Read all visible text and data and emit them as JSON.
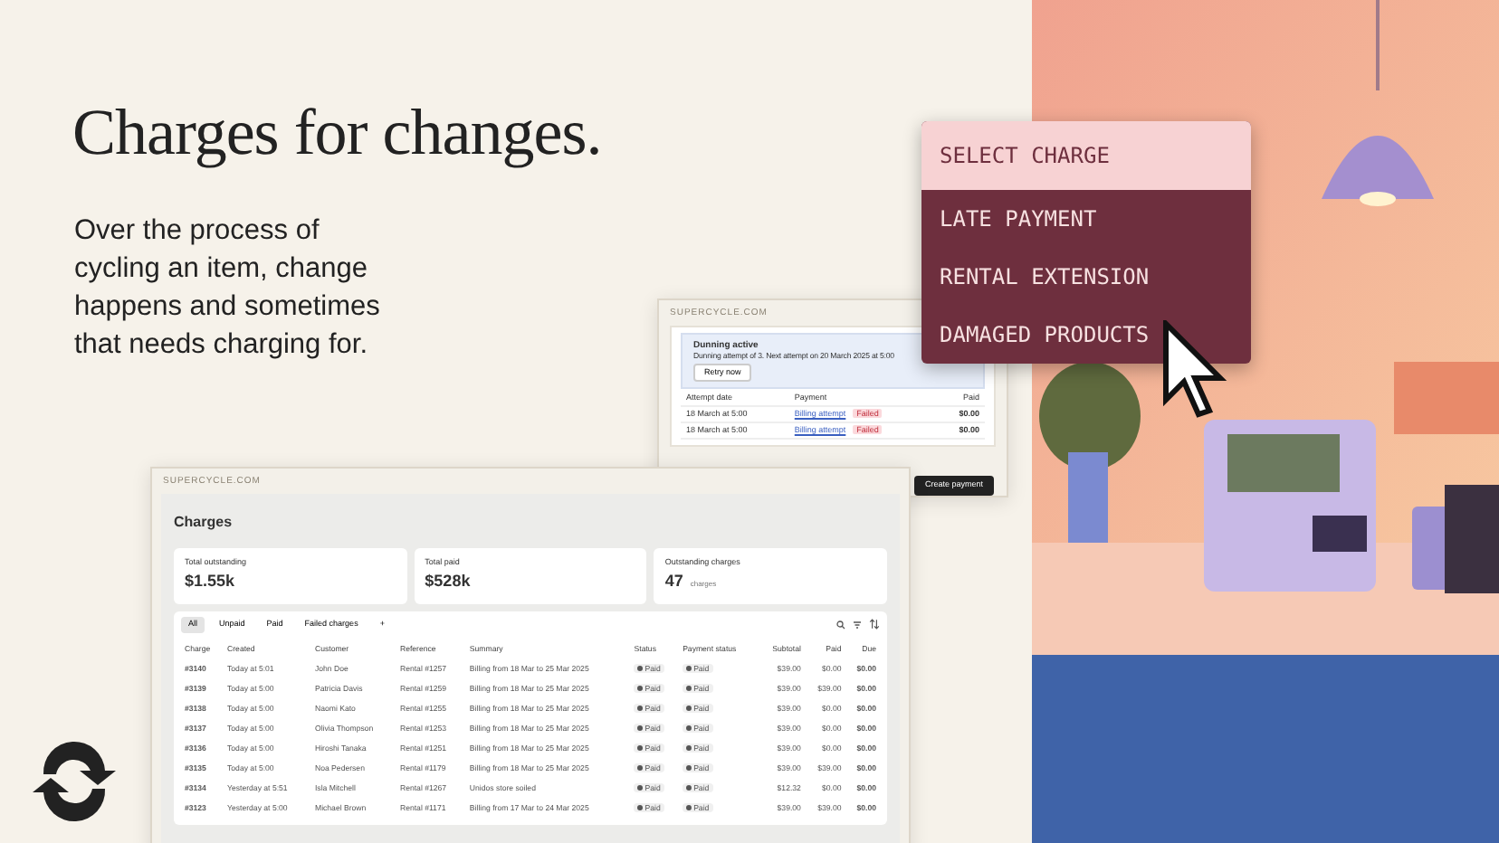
{
  "headline": "Charges for changes.",
  "body": "Over the process of cycling an item, change happens and sometimes that needs charging for.",
  "back_window": {
    "title": "SUPERCYCLE.COM",
    "alert": {
      "title": "Dunning active",
      "text": "Dunning attempt of 3. Next attempt on 20 March 2025 at 5:00",
      "button": "Retry now"
    },
    "columns": [
      "Attempt date",
      "Payment",
      "Paid"
    ],
    "rows": [
      {
        "date": "18 March at 5:00",
        "payment": "Billing attempt",
        "status": "Failed",
        "paid": "$0.00"
      },
      {
        "date": "18 March at 5:00",
        "payment": "Billing attempt",
        "status": "Failed",
        "paid": "$0.00"
      }
    ],
    "button": "Create payment"
  },
  "menu": {
    "header": "SELECT CHARGE",
    "items": [
      "LATE PAYMENT",
      "RENTAL EXTENSION",
      "DAMAGED PRODUCTS"
    ]
  },
  "front_window": {
    "title": "SUPERCYCLE.COM",
    "heading": "Charges",
    "stats": [
      {
        "label": "Total outstanding",
        "value": "$1.55k"
      },
      {
        "label": "Total paid",
        "value": "$528k"
      },
      {
        "label": "Outstanding charges",
        "value": "47",
        "unit": "charges"
      }
    ],
    "filters": [
      {
        "label": "All",
        "selected": true
      },
      {
        "label": "Unpaid",
        "selected": false
      },
      {
        "label": "Paid",
        "selected": false
      },
      {
        "label": "Failed charges",
        "selected": false
      },
      {
        "label": "+",
        "selected": false
      }
    ],
    "columns": [
      "Charge",
      "Created",
      "Customer",
      "Reference",
      "Summary",
      "Status",
      "Payment status",
      "Subtotal",
      "Paid",
      "Due"
    ],
    "rows": [
      [
        "#3140",
        "Today at 5:01",
        "John Doe",
        "Rental #1257",
        "Billing from 18 Mar to 25 Mar 2025",
        "Paid",
        "Paid",
        "$39.00",
        "$0.00",
        "$0.00"
      ],
      [
        "#3139",
        "Today at 5:00",
        "Patricia Davis",
        "Rental #1259",
        "Billing from 18 Mar to 25 Mar 2025",
        "Paid",
        "Paid",
        "$39.00",
        "$39.00",
        "$0.00"
      ],
      [
        "#3138",
        "Today at 5:00",
        "Naomi Kato",
        "Rental #1255",
        "Billing from 18 Mar to 25 Mar 2025",
        "Paid",
        "Paid",
        "$39.00",
        "$0.00",
        "$0.00"
      ],
      [
        "#3137",
        "Today at 5:00",
        "Olivia Thompson",
        "Rental #1253",
        "Billing from 18 Mar to 25 Mar 2025",
        "Paid",
        "Paid",
        "$39.00",
        "$0.00",
        "$0.00"
      ],
      [
        "#3136",
        "Today at 5:00",
        "Hiroshi Tanaka",
        "Rental #1251",
        "Billing from 18 Mar to 25 Mar 2025",
        "Paid",
        "Paid",
        "$39.00",
        "$0.00",
        "$0.00"
      ],
      [
        "#3135",
        "Today at 5:00",
        "Noa Pedersen",
        "Rental #1179",
        "Billing from 18 Mar to 25 Mar 2025",
        "Paid",
        "Paid",
        "$39.00",
        "$39.00",
        "$0.00"
      ],
      [
        "#3134",
        "Yesterday at 5:51",
        "Isla Mitchell",
        "Rental #1267",
        "Unidos store soiled",
        "Paid",
        "Paid",
        "$12.32",
        "$0.00",
        "$0.00"
      ],
      [
        "#3123",
        "Yesterday at 5:00",
        "Michael Brown",
        "Rental #1171",
        "Billing from 17 Mar to 24 Mar 2025",
        "Paid",
        "Paid",
        "$39.00",
        "$39.00",
        "$0.00"
      ]
    ]
  }
}
